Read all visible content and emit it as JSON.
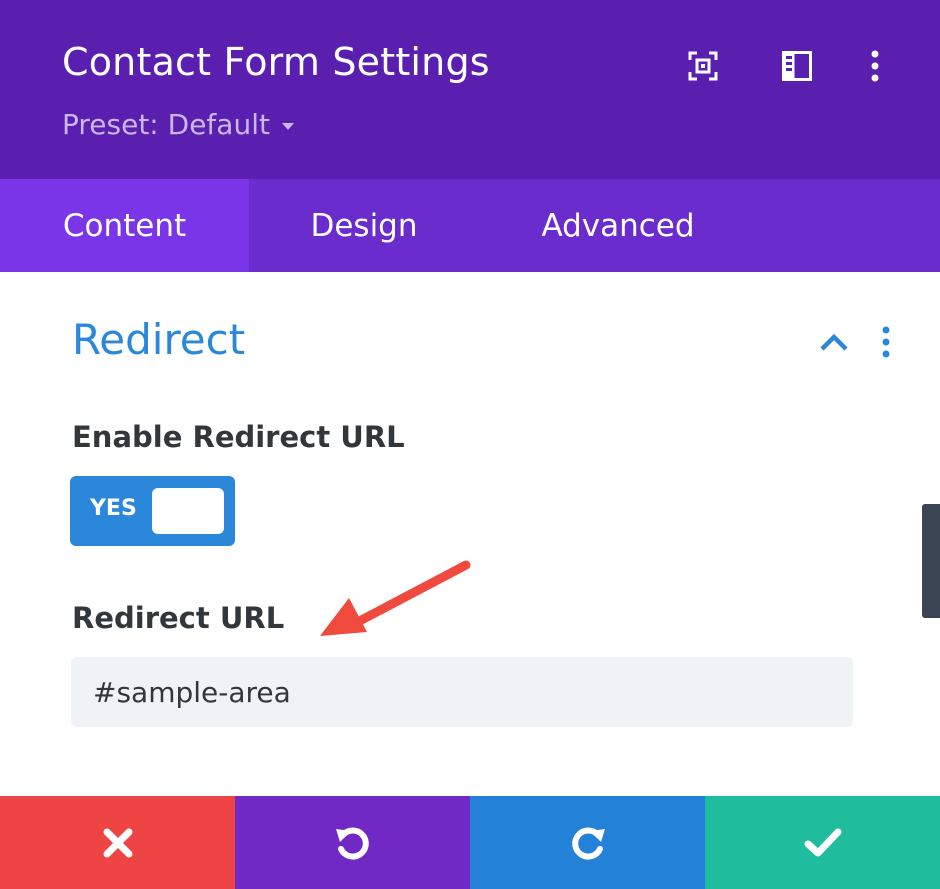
{
  "header": {
    "title": "Contact Form Settings",
    "preset_label": "Preset: Default",
    "icons": [
      "focus-mode-icon",
      "sidebar-layout-icon",
      "more-options-icon"
    ]
  },
  "tabs": [
    {
      "label": "Content",
      "active": true
    },
    {
      "label": "Design",
      "active": false
    },
    {
      "label": "Advanced",
      "active": false
    }
  ],
  "section": {
    "title": "Redirect",
    "expanded": true,
    "icons": [
      "chevron-up-icon",
      "more-options-icon"
    ]
  },
  "fields": {
    "enable_redirect": {
      "label": "Enable Redirect URL",
      "value": "YES"
    },
    "redirect_url": {
      "label": "Redirect URL",
      "value": "#sample-area"
    }
  },
  "annotation": {
    "icon": "red-arrow-icon",
    "color": "#f04a3e"
  },
  "footer": {
    "buttons": [
      {
        "icon": "close-icon",
        "color": "#ef4444"
      },
      {
        "icon": "undo-icon",
        "color": "#7029c4"
      },
      {
        "icon": "redo-icon",
        "color": "#2382d8"
      },
      {
        "icon": "check-icon",
        "color": "#1fbc9e"
      }
    ]
  },
  "colors": {
    "header_bg": "#5b1fb0",
    "tabs_bg": "#6a2ccc",
    "active_tab_bg": "#7b35e8",
    "accent_blue": "#2b87da"
  }
}
